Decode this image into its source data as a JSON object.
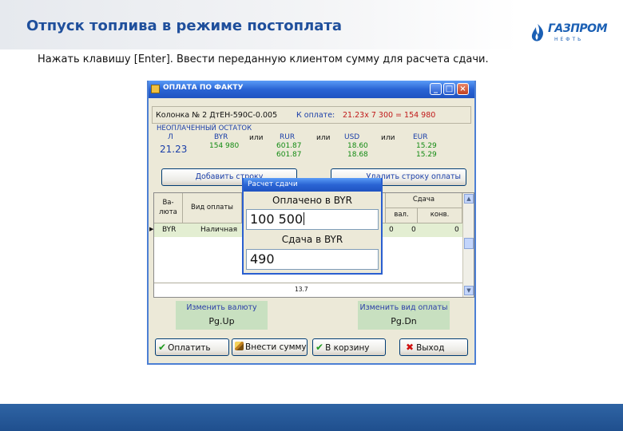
{
  "slide": {
    "title": "Отпуск топлива в режиме постоплата",
    "instruction": "Нажать клавишу [Enter]. Ввести переданную клиентом сумму для расчета сдачи.",
    "logo_text": "ГАЗПРОМ",
    "logo_sub": "НЕФТЬ"
  },
  "window": {
    "title": "ОПЛАТА ПО ФАКТУ",
    "controls": {
      "minimize": "_",
      "maximize": "□",
      "close": "×"
    },
    "info": {
      "column": "Колонка № 2 ДтЕН-590С-0.005",
      "to_pay_label": "К оплате:",
      "to_pay_value": "21.23х 7 300 = 154 980"
    },
    "remainder": {
      "title": "НЕОПЛАЧЕННЫЙ ОСТАТОК",
      "or": "или",
      "l_label": "Л",
      "l_value": "21.23",
      "byr_label": "BYR",
      "byr_value": "154 980",
      "rur_label": "RUR",
      "rur_value1": "601.87",
      "rur_value2": "601.87",
      "usd_label": "USD",
      "usd_value1": "18.60",
      "usd_value2": "18.68",
      "eur_label": "EUR",
      "eur_value1": "15.29",
      "eur_value2": "15.29"
    },
    "buttons": {
      "add_row": "Добавить строку",
      "delete_row": "Удалить строку оплаты",
      "pay": "Оплатить",
      "enter_sum": "Внести сумму",
      "to_cart": "В корзину",
      "exit": "Выход"
    },
    "grid": {
      "col_currency": "Ва-\nлюта",
      "col_pay_type": "Вид оплаты",
      "col_change": "Сдача",
      "col_change_cur": "вал.",
      "col_change_conv": "конв.",
      "row": {
        "currency": "BYR",
        "pay_type": "Наличная",
        "v1": "0",
        "v2": "0",
        "v3": "0"
      },
      "total": "13.7"
    },
    "panels": {
      "currency_label": "Изменить валюту",
      "currency_key": "Pg.Up",
      "paytype_label": "Изменить вид оплаты",
      "paytype_key": "Pg.Dn"
    }
  },
  "popup": {
    "title": "Расчет сдачи",
    "paid_label": "Оплачено в BYR",
    "paid_value": "100 500",
    "change_label": "Сдача в BYR",
    "change_value": "490"
  }
}
